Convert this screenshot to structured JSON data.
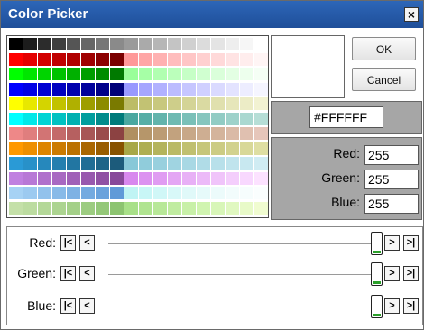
{
  "window": {
    "title": "Color Picker",
    "close_symbol": "×"
  },
  "palette": {
    "columns": 18,
    "rows": [
      [
        "#000000",
        "#1c1c1c",
        "#2c2c2c",
        "#3e3e3e",
        "#555555",
        "#666666",
        "#777777",
        "#8a8a8a",
        "#9a9a9a",
        "#aaaaaa",
        "#b6b6b6",
        "#c4c4c4",
        "#d0d0d0",
        "#dcdcdc",
        "#e4e4e4",
        "#eeeeee",
        "#f6f6f6",
        "#ffffff"
      ],
      [
        "#ff0000",
        "#e40000",
        "#d20000",
        "#c00000",
        "#b00000",
        "#a00000",
        "#8c0000",
        "#7a0000",
        "#ff9999",
        "#ffa6a6",
        "#ffb1b1",
        "#ffbdbd",
        "#ffc6c6",
        "#ffd0d0",
        "#ffd9d9",
        "#ffe3e3",
        "#ffeded",
        "#fff5f5"
      ],
      [
        "#00ff00",
        "#00e600",
        "#00d400",
        "#00c200",
        "#00b000",
        "#009e00",
        "#008c00",
        "#007a00",
        "#99ff99",
        "#a6ffa6",
        "#b1ffb1",
        "#bbffbb",
        "#c6ffc6",
        "#d0ffd0",
        "#daffda",
        "#e3ffe3",
        "#edffed",
        "#f5fff5"
      ],
      [
        "#0000ff",
        "#0000e6",
        "#0000d2",
        "#0000c0",
        "#0000ae",
        "#00009c",
        "#00008a",
        "#000078",
        "#9999ff",
        "#a6a6ff",
        "#b1b1ff",
        "#bcbcff",
        "#c6c6ff",
        "#d0d0ff",
        "#dadaff",
        "#e3e3ff",
        "#ededff",
        "#f5f5ff"
      ],
      [
        "#ffff00",
        "#e8e800",
        "#d4d400",
        "#c2c200",
        "#b0b000",
        "#9e9e00",
        "#8c8c00",
        "#7a7a00",
        "#bcbc66",
        "#c2c273",
        "#c8c87e",
        "#cece8a",
        "#d4d496",
        "#dadaa2",
        "#e0e0ae",
        "#e6e6ba",
        "#ececc6",
        "#f2f2d2"
      ],
      [
        "#00ffff",
        "#00e8e8",
        "#00d4d4",
        "#00c2c2",
        "#00b0b0",
        "#009e9e",
        "#008c8c",
        "#007a7a",
        "#4aa8a0",
        "#56aea6",
        "#62b4ac",
        "#6ebab2",
        "#7ac0b8",
        "#86c6be",
        "#92ccc4",
        "#9ed2ca",
        "#aad8d0",
        "#b6ded6"
      ],
      [
        "#ee8888",
        "#e07e7e",
        "#d27474",
        "#c46a6a",
        "#b66060",
        "#a85656",
        "#9a4c4c",
        "#8c4242",
        "#b09060",
        "#b6966a",
        "#bc9c74",
        "#c2a27e",
        "#c8a888",
        "#ceae92",
        "#d4b49c",
        "#dabaa6",
        "#e0c0b0",
        "#e6c6ba"
      ],
      [
        "#ff9900",
        "#ee8f00",
        "#dd8500",
        "#cc7b00",
        "#bb7100",
        "#aa6700",
        "#995d00",
        "#885300",
        "#a8a848",
        "#aeae52",
        "#b4b45c",
        "#baba66",
        "#c0c070",
        "#c6c67a",
        "#cccc84",
        "#d2d28e",
        "#d8d898",
        "#dedea2"
      ],
      [
        "#2a9ad6",
        "#2891c9",
        "#2688bc",
        "#247faf",
        "#2276a2",
        "#206d95",
        "#1e6488",
        "#1c5b7b",
        "#88c8d8",
        "#90ccdb",
        "#98d0de",
        "#a0d4e1",
        "#a8d8e4",
        "#b0dce7",
        "#b8e0ea",
        "#c0e4ed",
        "#c8e8f0",
        "#d0ecf3"
      ],
      [
        "#c080e0",
        "#b878d6",
        "#b070cc",
        "#a868c2",
        "#a060b8",
        "#9858ae",
        "#9050a4",
        "#88489a",
        "#d888ee",
        "#dc92f0",
        "#e09cf2",
        "#e4a6f4",
        "#e8b0f6",
        "#ecbaf8",
        "#f0c4fa",
        "#f4cefc",
        "#f8d8fe",
        "#fce2ff"
      ],
      [
        "#a6d2f4",
        "#9ccaf0",
        "#92c2ec",
        "#88bae8",
        "#7eb2e4",
        "#74aae0",
        "#6aa2dc",
        "#609ad8",
        "#c0f4f4",
        "#c8f6f6",
        "#d0f7f7",
        "#d8f8f8",
        "#e0f9f9",
        "#e6fafa",
        "#ecfbfb",
        "#f2fcfc",
        "#f6fdfd",
        "#fafefe"
      ],
      [
        "#c4e0a8",
        "#bcdca0",
        "#b4d898",
        "#acd490",
        "#a4d088",
        "#9ccc80",
        "#94c878",
        "#8cc470",
        "#a8e088",
        "#b0e490",
        "#b8e898",
        "#c0eca0",
        "#c8f0a8",
        "#d0f4b0",
        "#d8f6b8",
        "#e0f8c0",
        "#e8fac8",
        "#f0fcd0"
      ]
    ]
  },
  "buttons": {
    "ok": "OK",
    "cancel": "Cancel"
  },
  "current_color": {
    "swatch": "#FFFFFF",
    "hex_value": "#FFFFFF"
  },
  "rgb_fields": {
    "red_label": "Red:",
    "red_value": "255",
    "green_label": "Green:",
    "green_value": "255",
    "blue_label": "Blue:",
    "blue_value": "255"
  },
  "sliders": [
    {
      "label": "Red:",
      "value": 255,
      "max": 255
    },
    {
      "label": "Green:",
      "value": 255,
      "max": 255
    },
    {
      "label": "Blue:",
      "value": 255,
      "max": 255
    }
  ],
  "slider_buttons": {
    "first": "|<",
    "prev": "<",
    "next": ">",
    "last": ">|"
  },
  "icons": {
    "first": "skip-first-icon",
    "prev": "step-back-icon",
    "next": "step-forward-icon",
    "last": "skip-last-icon",
    "close": "close-icon"
  }
}
